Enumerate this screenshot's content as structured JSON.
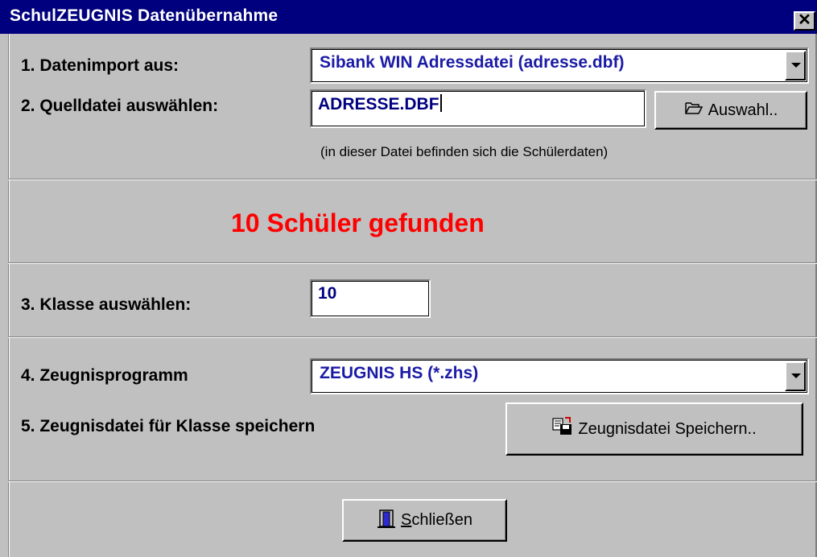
{
  "window": {
    "title": "SchulZEUGNIS Datenübernahme",
    "close_glyph": "✕"
  },
  "import": {
    "label": "1. Datenimport aus:",
    "selected": "Sibank WIN Adressdatei (adresse.dbf)"
  },
  "source": {
    "label": "2. Quelldatei auswählen:",
    "value": "ADRESSE.DBF",
    "browse_button": "Auswahl..",
    "hint": "(in dieser Datei befinden sich die Schülerdaten)"
  },
  "status": {
    "text": "10 Schüler gefunden",
    "color": "#ff0000"
  },
  "class": {
    "label": "3. Klasse auswählen:",
    "value": "10"
  },
  "program": {
    "label": "4. Zeugnisprogramm",
    "selected": "ZEUGNIS HS (*.zhs)"
  },
  "save": {
    "label": "5. Zeugnisdatei für Klasse speichern",
    "button": "Zeugnisdatei Speichern.."
  },
  "close_button": {
    "mnemonic": "S",
    "rest": "chließen"
  },
  "icons": {
    "browse": "folder-open-icon",
    "save": "save-document-icon",
    "close": "door-exit-icon"
  }
}
